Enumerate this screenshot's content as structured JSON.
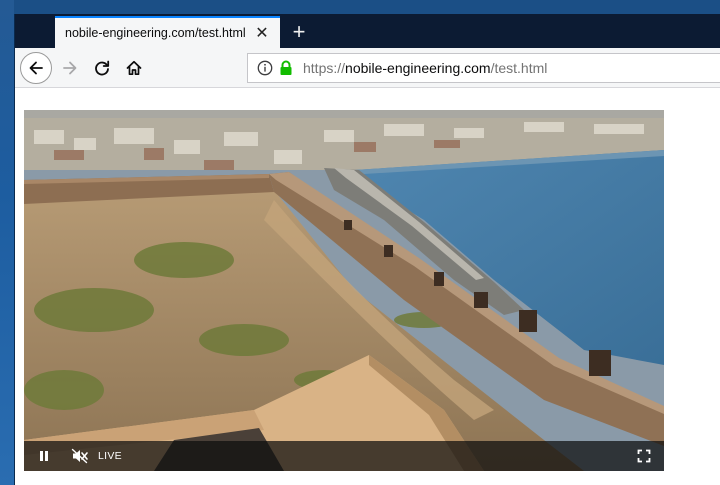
{
  "browser": {
    "tab": {
      "title": "nobile-engineering.com/test.html",
      "close_glyph": "✕"
    },
    "new_tab_glyph": "+",
    "url": {
      "protocol": "https://",
      "host": "nobile-engineering.com",
      "path": "/test.html"
    },
    "icons": {
      "back": "back-arrow-icon",
      "forward": "forward-arrow-icon",
      "reload": "reload-icon",
      "home": "home-icon",
      "info": "info-icon",
      "lock": "lock-icon"
    },
    "colors": {
      "tabstrip": "#0c1b33",
      "tab_accent": "#0a84ff",
      "lock_green": "#12bc00"
    }
  },
  "video": {
    "live_label": "LIVE",
    "icons": {
      "pause": "pause-icon",
      "mute": "muted-speaker-icon",
      "fullscreen": "fullscreen-icon"
    },
    "scene_description_icon": "fortress-wall-coastline-video-frame"
  }
}
